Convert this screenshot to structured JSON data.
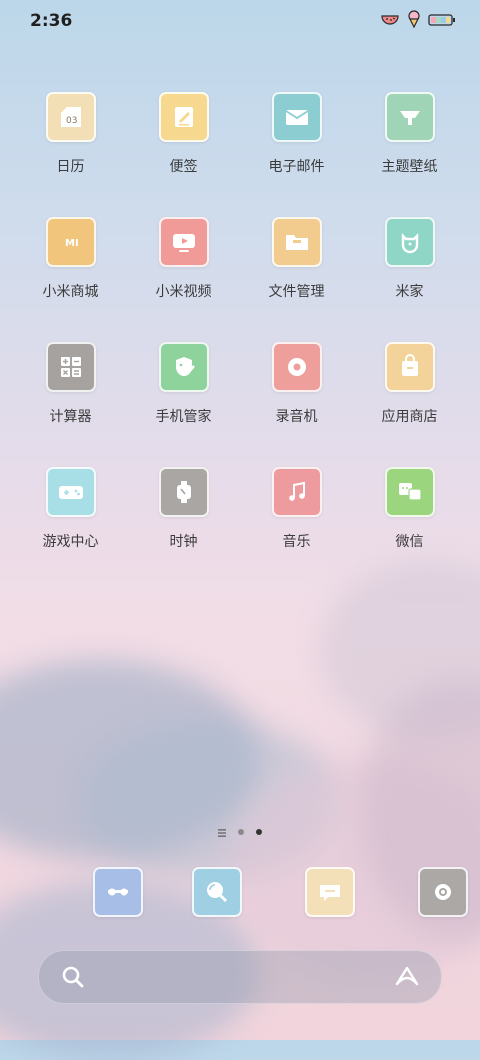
{
  "status_bar": {
    "time": "2:36"
  },
  "apps": [
    {
      "label": "日历",
      "icon": "calendar-icon",
      "color": "#f3dfb6",
      "badge": "03"
    },
    {
      "label": "便签",
      "icon": "notes-icon",
      "color": "#f6d98f"
    },
    {
      "label": "电子邮件",
      "icon": "mail-icon",
      "color": "#8ccdd1"
    },
    {
      "label": "主题壁纸",
      "icon": "theme-icon",
      "color": "#9fd4b6"
    },
    {
      "label": "小米商城",
      "icon": "mi-store-icon",
      "color": "#f2c57c",
      "badge": "MI"
    },
    {
      "label": "小米视频",
      "icon": "video-icon",
      "color": "#f19b98"
    },
    {
      "label": "文件管理",
      "icon": "folder-icon",
      "color": "#f2cc8e"
    },
    {
      "label": "米家",
      "icon": "mijia-icon",
      "color": "#8fd6c7"
    },
    {
      "label": "计算器",
      "icon": "calculator-icon",
      "color": "#a6a2a0"
    },
    {
      "label": "手机管家",
      "icon": "security-icon",
      "color": "#8ed29c"
    },
    {
      "label": "录音机",
      "icon": "recorder-icon",
      "color": "#ee9f9c"
    },
    {
      "label": "应用商店",
      "icon": "app-store-icon",
      "color": "#f3d39a"
    },
    {
      "label": "游戏中心",
      "icon": "gamepad-icon",
      "color": "#a8dfe6"
    },
    {
      "label": "时钟",
      "icon": "clock-icon",
      "color": "#a9a6a4"
    },
    {
      "label": "音乐",
      "icon": "music-icon",
      "color": "#ee9b9f"
    },
    {
      "label": "微信",
      "icon": "wechat-icon",
      "color": "#9bd67e"
    }
  ],
  "dock": [
    {
      "icon": "phone-icon",
      "color": "#a7bfe6"
    },
    {
      "icon": "browser-icon",
      "color": "#9fcfe2"
    },
    {
      "icon": "messages-icon",
      "color": "#f3dfb8"
    },
    {
      "icon": "camera-icon",
      "color": "#aba8a6"
    }
  ],
  "page_indicator": {
    "pages": 3,
    "current": 3
  }
}
